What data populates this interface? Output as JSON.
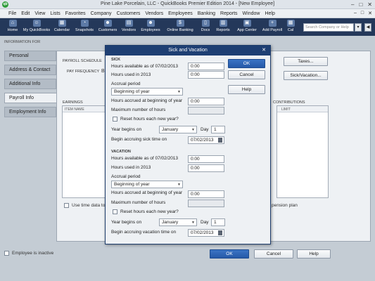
{
  "window": {
    "title": "Pine Lake Porcelain, LLC  - QuickBooks Premier Edition 2014 - [New Employee]",
    "logo": "qb",
    "buttons": [
      "–",
      "□",
      "✕"
    ]
  },
  "menubar": {
    "items": [
      "File",
      "Edit",
      "View",
      "Lists",
      "Favorites",
      "Company",
      "Customers",
      "Vendors",
      "Employees",
      "Banking",
      "Reports",
      "Window",
      "Help"
    ],
    "window_controls": [
      "–",
      "□",
      "✕"
    ]
  },
  "toolbar": {
    "items": [
      {
        "label": "Home",
        "icon": "home-icon"
      },
      {
        "label": "My QuickBooks",
        "icon": "my-quickbooks-icon"
      },
      {
        "label": "Calendar",
        "icon": "calendar-icon"
      },
      {
        "label": "Snapshots",
        "icon": "snapshots-icon"
      },
      {
        "label": "Customers",
        "icon": "customers-icon"
      },
      {
        "label": "Vendors",
        "icon": "vendors-icon"
      },
      {
        "label": "Employees",
        "icon": "employees-icon"
      },
      {
        "label": "Online Banking",
        "icon": "online-banking-icon"
      },
      {
        "label": "Docs",
        "icon": "docs-icon"
      },
      {
        "label": "Reports",
        "icon": "reports-icon"
      },
      {
        "label": "App Center",
        "icon": "app-center-icon"
      },
      {
        "label": "Add Payroll",
        "icon": "add-payroll-icon"
      },
      {
        "label": "Cal",
        "icon": "cal-icon"
      }
    ],
    "search_placeholder": "Search Company or Help",
    "search_button": "▾",
    "arrow_button": "◀",
    "dark_bg": "#24385a"
  },
  "employee": {
    "info_for": "INFORMATION FOR",
    "tabs": [
      "Personal",
      "Address & Contact",
      "Additional Info",
      "Payroll Info",
      "Employment Info"
    ],
    "active_tab": "Payroll Info",
    "payroll_schedule_label": "PAYROLL SCHEDULE",
    "pay_frequency_label": "PAY FREQUENCY",
    "pay_frequency_value": "B",
    "earnings_label": "EARNINGS",
    "item_name_header": "ITEM NAME",
    "contributions_label": "CONTRIBUTIONS",
    "limit_header": "LIMIT",
    "taxes_button": "Taxes...",
    "sick_vacation_button": "Sick/Vacation...",
    "use_time_data_label": "Use time data to",
    "pension_plan_label": "pension plan",
    "inactive_label": "Employee is inactive",
    "ok_button": "OK",
    "cancel_button": "Cancel",
    "help_button": "Help"
  },
  "dialog": {
    "title": "Sick and Vacation",
    "close": "✕",
    "ok": "OK",
    "cancel": "Cancel",
    "help": "Help",
    "sick": {
      "section": "SICK",
      "hours_available_label": "Hours available as of 07/02/2013",
      "hours_available_value": "0:00",
      "hours_used_label": "Hours used in 2013",
      "hours_used_value": "0:00",
      "accrual_period_label": "Accrual period",
      "accrual_period_value": "Beginning of year",
      "hours_accrued_label": "Hours accrued at beginning of year",
      "hours_accrued_value": "0:00",
      "max_hours_label": "Maximum number of hours",
      "max_hours_value": "",
      "reset_label": "Reset hours each new year?",
      "year_begins_label": "Year begins on",
      "year_begins_month": "January",
      "day_label": "Day",
      "day_value": "1",
      "begin_accruing_label": "Begin accruing sick time on",
      "begin_accruing_value": "07/02/2013"
    },
    "vacation": {
      "section": "VACATION",
      "hours_available_label": "Hours available as of 07/02/2013",
      "hours_available_value": "0:00",
      "hours_used_label": "Hours used in 2013",
      "hours_used_value": "0:00",
      "accrual_period_label": "Accrual period",
      "accrual_period_value": "Beginning of year",
      "hours_accrued_label": "Hours accrued at beginning of year",
      "hours_accrued_value": "0:00",
      "max_hours_label": "Maximum number of hours",
      "max_hours_value": "",
      "reset_label": "Reset hours each new year?",
      "year_begins_label": "Year begins on",
      "year_begins_month": "January",
      "day_label": "Day",
      "day_value": "1",
      "begin_accruing_label": "Begin accruing vacation time on",
      "begin_accruing_value": "07/02/2013"
    }
  }
}
